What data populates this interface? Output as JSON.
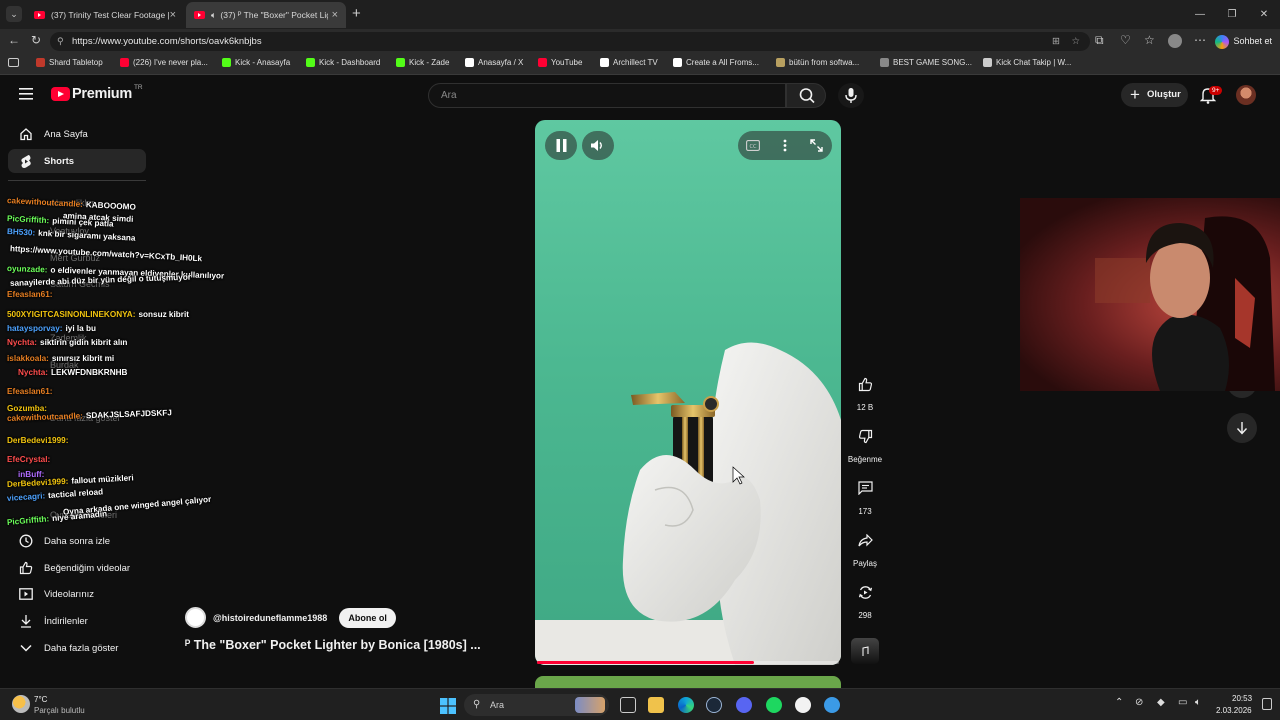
{
  "browser": {
    "tabs": [
      {
        "title": "(37) Trinity Test Clear Footage | Op"
      },
      {
        "title": "(37) ᴾ The \"Boxer\" Pocket Lig"
      }
    ],
    "url": "https://www.youtube.com/shorts/oavk6knbjbs",
    "chat_button": "Sohbet et",
    "bookmarks": [
      {
        "label": "Shard Tabletop",
        "color": "#c0392b"
      },
      {
        "label": "(226) I've never pla...",
        "color": "#ff0033"
      },
      {
        "label": "Kick - Anasayfa",
        "color": "#53fc18"
      },
      {
        "label": "Kick - Dashboard",
        "color": "#53fc18"
      },
      {
        "label": "Kick - Zade",
        "color": "#53fc18"
      },
      {
        "label": "Anasayfa / X",
        "color": "#ffffff"
      },
      {
        "label": "YouTube",
        "color": "#ff0033"
      },
      {
        "label": "Archillect TV",
        "color": "#ffffff"
      },
      {
        "label": "Create a All Froms...",
        "color": "#ffffff"
      },
      {
        "label": "bütün from softwa...",
        "color": "#b8a060"
      },
      {
        "label": "BEST GAME SONG...",
        "color": "#888888"
      },
      {
        "label": "Kick Chat Takip | W...",
        "color": "#cccccc"
      }
    ]
  },
  "youtube": {
    "logo_text": "Premium",
    "logo_region": "TR",
    "search_placeholder": "Ara",
    "create_label": "Oluştur",
    "notif_badge": "9+",
    "sidebar": {
      "home": "Ana Sayfa",
      "shorts": "Shorts",
      "watch_later": "Daha sonra izle",
      "liked": "Beğendiğim videolar",
      "your_videos": "Videolarınız",
      "downloads": "İndirilenler",
      "show_more": "Daha fazla göster"
    },
    "short": {
      "channel": "@histoireduneflamme1988",
      "subscribe": "Abone ol",
      "title": "ᴾ The \"Boxer\" Pocket Lighter by Bonica [1980s] ...",
      "likes": "12 B",
      "dislike_label": "Beğenme",
      "comments": "173",
      "share_label": "Paylaş",
      "remixes": "298",
      "progress": 0.72
    }
  },
  "chat": [
    {
      "user": "cakewithoutcandle:",
      "msg": "KABOOOMO",
      "color": "#e67e22"
    },
    {
      "user": "",
      "msg": "amina atcak simdi",
      "color": "#ffffff"
    },
    {
      "user": "PicGriffith:",
      "msg": "pimini çek patla",
      "color": "#6cff5a"
    },
    {
      "user": "BH530:",
      "msg": "knk bir sigaramı yaksana",
      "color": "#4ea3ff"
    },
    {
      "user": "",
      "msg": "https://www.youtube.com/watch?v=KCxTb_IH0Lk",
      "color": "#ffffff"
    },
    {
      "user": "oyunzade:",
      "msg": "o eldivenler yanmayan eldivenler kullanılıyor",
      "color": "#6cff5a"
    },
    {
      "user": "",
      "msg": "sanayilerde abi düz bir yün değil o tutuşmuyor",
      "color": "#ffffff"
    },
    {
      "user": "Efeaslan61:",
      "msg": "",
      "color": "#e67e22"
    },
    {
      "user": "500XYIGITCASINONLINEKONYA:",
      "msg": "sonsuz kibrit",
      "color": "#f1c40f"
    },
    {
      "user": "hataysporvay:",
      "msg": "iyi la bu",
      "color": "#4ea3ff"
    },
    {
      "user": "Nychta:",
      "msg": "siktirin gidin kibrit alın",
      "color": "#ff4d4d"
    },
    {
      "user": "islakkoala:",
      "msg": "sınırsız kibrit mi",
      "color": "#e67e22"
    },
    {
      "user": "Nychta:",
      "msg": "LEKWFDNBKRNHB",
      "color": "#ff4d4d"
    },
    {
      "user": "Efeaslan61:",
      "msg": "",
      "color": "#e67e22"
    },
    {
      "user": "Gozumba:",
      "msg": "",
      "color": "#f1c40f"
    },
    {
      "user": "cakewithoutcandle:",
      "msg": "SDAKJSLSAFJDSKFJ",
      "color": "#e67e22"
    },
    {
      "user": "DerBedevi1999:",
      "msg": "",
      "color": "#f1c40f"
    },
    {
      "user": "EfeCrystal:",
      "msg": "",
      "color": "#ff4d4d"
    },
    {
      "user": "inBuff:",
      "msg": "",
      "color": "#b06cff"
    },
    {
      "user": "DerBedevi1999:",
      "msg": "fallout müzikleri",
      "color": "#f1c40f"
    },
    {
      "user": "vicecagri:",
      "msg": "tactical reload",
      "color": "#4ea3ff"
    },
    {
      "user": "",
      "msg": "Oyna arkada one winged angel çalıyor",
      "color": "#ffffff"
    },
    {
      "user": "PicGriffith:",
      "msg": "niye aramadin",
      "color": "#6cff5a"
    }
  ],
  "taskbar": {
    "weather_temp": "7°C",
    "weather_desc": "Parçalı bulutlu",
    "search_label": "Ara",
    "time": "20:53",
    "date": "2.03.2026"
  }
}
